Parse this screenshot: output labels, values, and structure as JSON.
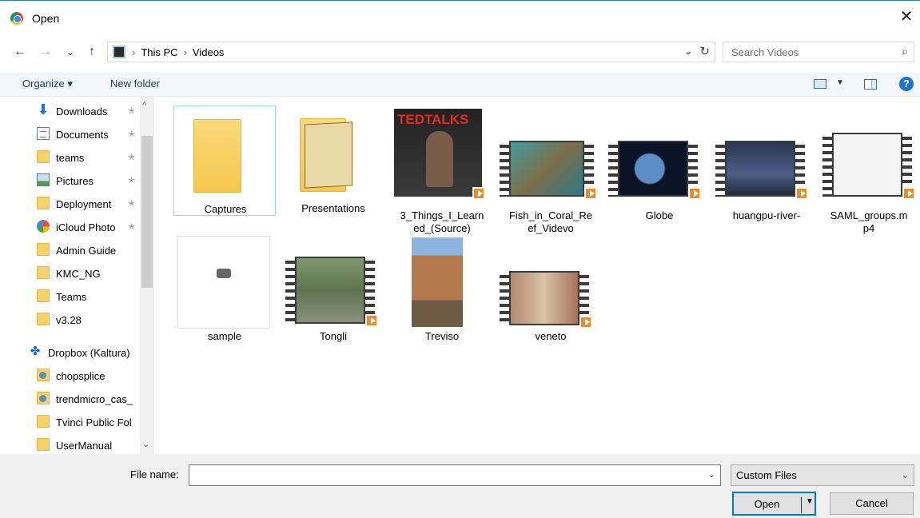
{
  "window": {
    "title": "Open",
    "close": "✕"
  },
  "nav": {
    "back": "←",
    "forward": "→",
    "recent": "⌄",
    "up": "↑"
  },
  "address": {
    "crumbs": [
      "This PC",
      "Videos"
    ],
    "separator": "›",
    "dropdown": "⌄",
    "refresh": "↻"
  },
  "search": {
    "placeholder": "Search Videos",
    "icon": "⌕"
  },
  "toolbar": {
    "organize": "Organize ▾",
    "new_folder": "New folder",
    "view_dropdown": "▼",
    "help": "?"
  },
  "sidebar": {
    "items": [
      {
        "label": "Downloads",
        "icon": "download-icon",
        "pinned": true
      },
      {
        "label": "Documents",
        "icon": "documents-icon",
        "pinned": true
      },
      {
        "label": "teams",
        "icon": "folder-icon",
        "pinned": true
      },
      {
        "label": "Pictures",
        "icon": "pictures-icon",
        "pinned": true
      },
      {
        "label": "Deployment",
        "icon": "folder-icon",
        "pinned": true
      },
      {
        "label": "iCloud Photo",
        "icon": "icloud-icon",
        "pinned": true
      },
      {
        "label": "Admin Guide",
        "icon": "folder-icon",
        "pinned": false
      },
      {
        "label": "KMC_NG",
        "icon": "folder-icon",
        "pinned": false
      },
      {
        "label": "Teams",
        "icon": "folder-icon",
        "pinned": false
      },
      {
        "label": "v3.28",
        "icon": "folder-icon",
        "pinned": false
      },
      {
        "label": "Dropbox (Kaltura)",
        "icon": "dropbox-icon",
        "pinned": false
      },
      {
        "label": "chopsplice",
        "icon": "shared-folder-icon",
        "pinned": false
      },
      {
        "label": "trendmicro_cas_",
        "icon": "shared-folder-icon",
        "pinned": false
      },
      {
        "label": "Tvinci Public Fol",
        "icon": "shared-folder-icon",
        "pinned": false
      },
      {
        "label": "UserManual",
        "icon": "synced-folder-icon",
        "pinned": false
      }
    ],
    "pin_glyph": "📌",
    "scroll_up": "^",
    "scroll_down": "⌄"
  },
  "files": [
    {
      "name": "Captures",
      "kind": "folder",
      "selected": true
    },
    {
      "name": "Presentations",
      "kind": "folder-doc"
    },
    {
      "name": "3_Things_I_Learned_(Source)",
      "caption_lines": [
        "3_Things_I_Learn",
        "ed_(Source)"
      ],
      "kind": "video-ted",
      "thumb_text": "TEDTALKS"
    },
    {
      "name": "Fish_in_Coral_Reef_Videvo",
      "caption_lines": [
        "Fish_in_Coral_Re",
        "ef_Videvo"
      ],
      "kind": "video"
    },
    {
      "name": "Globe",
      "kind": "video"
    },
    {
      "name": "huangpu-river-",
      "kind": "video"
    },
    {
      "name": "SAML_groups.mp4",
      "caption_lines": [
        "SAML_groups.m",
        "p4"
      ],
      "kind": "video"
    },
    {
      "name": "sample",
      "kind": "file"
    },
    {
      "name": "Tongli",
      "kind": "video"
    },
    {
      "name": "Treviso",
      "kind": "video-portrait"
    },
    {
      "name": "veneto",
      "kind": "video"
    }
  ],
  "footer": {
    "file_name_label": "File name:",
    "file_name_value": "",
    "file_name_dropdown": "⌄",
    "file_type": "Custom Files",
    "file_type_dropdown": "⌄",
    "open": "Open",
    "open_arrow": "▼",
    "cancel": "Cancel"
  },
  "colors": {
    "accent": "#0078d7",
    "toolbar_bg": "#f3f6fa",
    "footer_bg": "#f0f0f0",
    "selection": "#99d1ff"
  }
}
